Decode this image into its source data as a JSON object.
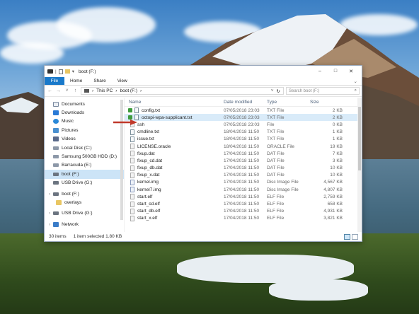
{
  "window": {
    "title": "boot (F:)",
    "quick_access_separator": "|",
    "quick_access_dropdown": "▾",
    "controls": {
      "minimize": "–",
      "maximize": "□",
      "close": "✕"
    }
  },
  "ribbon": {
    "file": "File",
    "tabs": [
      "Home",
      "Share",
      "View"
    ],
    "expand": "⌄"
  },
  "address": {
    "back": "←",
    "forward": "→",
    "up": "↑",
    "recent": "˅",
    "crumbs": [
      "This PC",
      "boot (F:)"
    ],
    "separator": "›",
    "dropdown": "˅",
    "refresh": "↻",
    "search_placeholder": "Search boot (F:)",
    "search_icon": "⌕"
  },
  "sidebar": {
    "items": [
      {
        "label": "Documents",
        "icon": "documents-icon"
      },
      {
        "label": "Downloads",
        "icon": "downloads-icon"
      },
      {
        "label": "Music",
        "icon": "music-icon"
      },
      {
        "label": "Pictures",
        "icon": "pictures-icon"
      },
      {
        "label": "Videos",
        "icon": "videos-icon"
      },
      {
        "label": "Local Disk (C:)",
        "icon": "drive-icon"
      },
      {
        "label": "Samsung 500GB HDD (D:)",
        "icon": "drive-icon"
      },
      {
        "label": "Barracuda (E:)",
        "icon": "drive-icon"
      },
      {
        "label": "boot (F:)",
        "icon": "usb-drive-icon",
        "selected": true
      },
      {
        "label": "USB Drive (G:)",
        "icon": "usb-drive-icon"
      },
      {
        "label": "boot (F:)",
        "icon": "usb-drive-icon"
      },
      {
        "label": "overlays",
        "icon": "folder-icon"
      },
      {
        "label": "USB Drive (G:)",
        "icon": "usb-drive-icon"
      },
      {
        "label": "Network",
        "icon": "network-icon"
      }
    ]
  },
  "columns": {
    "name": "Name",
    "date": "Date modified",
    "type": "Type",
    "size": "Size",
    "sort_arrow": "˄"
  },
  "files": [
    {
      "name": "config.txt",
      "date": "07/05/2018 23:03",
      "type": "TXT File",
      "size": "2 KB",
      "icon": "text-file-icon"
    },
    {
      "name": "octopi-wpa-supplicant.txt",
      "date": "07/05/2018 23:03",
      "type": "TXT File",
      "size": "2 KB",
      "icon": "text-file-icon",
      "highlighted": true
    },
    {
      "name": "ssh",
      "date": "07/05/2018 23:03",
      "type": "File",
      "size": "0 KB",
      "icon": "file-icon"
    },
    {
      "name": "cmdline.txt",
      "date": "18/04/2018 11:50",
      "type": "TXT File",
      "size": "1 KB",
      "icon": "text-file-icon"
    },
    {
      "name": "issue.txt",
      "date": "18/04/2018 11:50",
      "type": "TXT File",
      "size": "1 KB",
      "icon": "text-file-icon"
    },
    {
      "name": "LICENSE.oracle",
      "date": "18/04/2018 11:50",
      "type": "ORACLE File",
      "size": "19 KB",
      "icon": "file-icon"
    },
    {
      "name": "fixup.dat",
      "date": "17/04/2018 11:50",
      "type": "DAT File",
      "size": "7 KB",
      "icon": "file-icon"
    },
    {
      "name": "fixup_cd.dat",
      "date": "17/04/2018 11:50",
      "type": "DAT File",
      "size": "3 KB",
      "icon": "file-icon"
    },
    {
      "name": "fixup_db.dat",
      "date": "17/04/2018 11:50",
      "type": "DAT File",
      "size": "10 KB",
      "icon": "file-icon"
    },
    {
      "name": "fixup_x.dat",
      "date": "17/04/2018 11:50",
      "type": "DAT File",
      "size": "10 KB",
      "icon": "file-icon"
    },
    {
      "name": "kernel.img",
      "date": "17/04/2018 11:50",
      "type": "Disc Image File",
      "size": "4,567 KB",
      "icon": "disc-image-icon"
    },
    {
      "name": "kernel7.img",
      "date": "17/04/2018 11:50",
      "type": "Disc Image File",
      "size": "4,807 KB",
      "icon": "disc-image-icon"
    },
    {
      "name": "start.elf",
      "date": "17/04/2018 11:50",
      "type": "ELF File",
      "size": "2,759 KB",
      "icon": "file-icon"
    },
    {
      "name": "start_cd.elf",
      "date": "17/04/2018 11:50",
      "type": "ELF File",
      "size": "658 KB",
      "icon": "file-icon"
    },
    {
      "name": "start_db.elf",
      "date": "17/04/2018 11:50",
      "type": "ELF File",
      "size": "4,931 KB",
      "icon": "file-icon"
    },
    {
      "name": "start_x.elf",
      "date": "17/04/2018 11:50",
      "type": "ELF File",
      "size": "3,821 KB",
      "icon": "file-icon"
    }
  ],
  "status": {
    "count": "30 items",
    "selection": "1 item selected  1.80 KB"
  },
  "colors": {
    "accent": "#1979ca",
    "selection": "#cce4f7",
    "arrow": "#c0392b"
  }
}
